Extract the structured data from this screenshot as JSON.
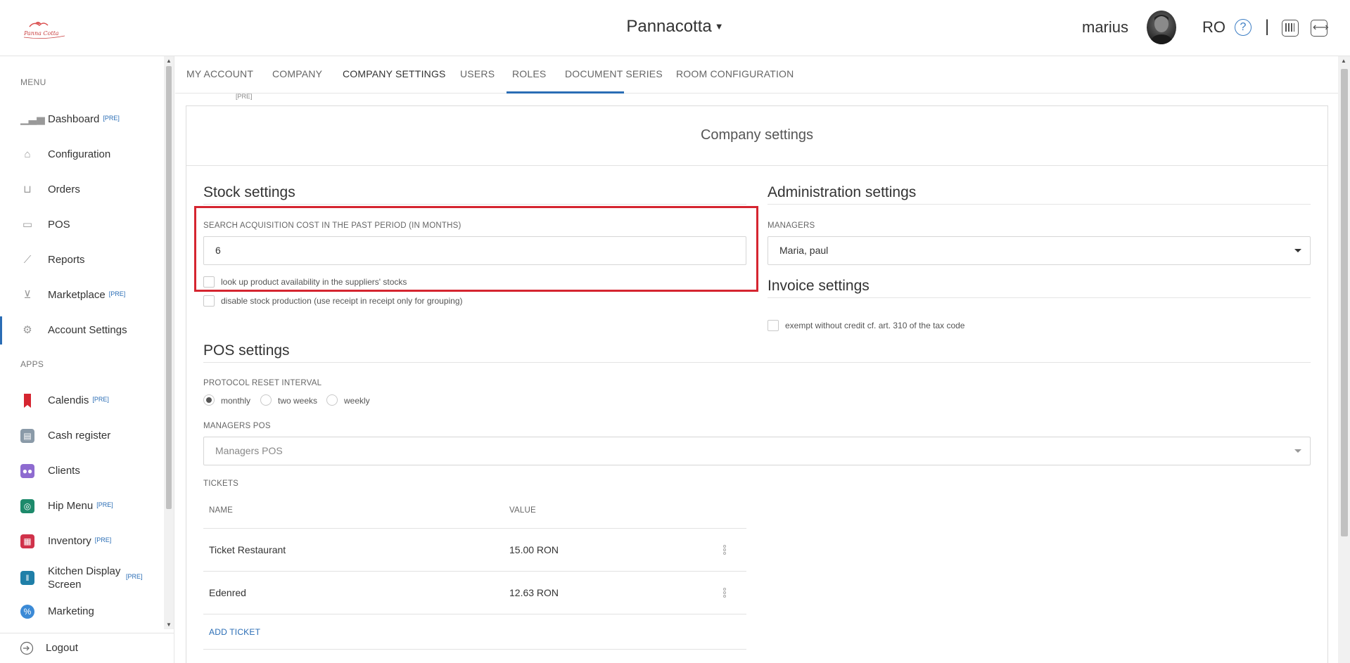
{
  "header": {
    "company_name": "Pannacotta",
    "user_name": "marius",
    "language": "RO",
    "help_icon": "question-circle-icon",
    "separator": "|"
  },
  "sidebar": {
    "menu_title": "MENU",
    "apps_title": "APPS",
    "menu_items": [
      {
        "label": "Dashboard",
        "badge": "[PRE]",
        "icon": "bar-chart-icon"
      },
      {
        "label": "Configuration",
        "badge": "",
        "icon": "tag-icon"
      },
      {
        "label": "Orders",
        "badge": "",
        "icon": "basket-icon"
      },
      {
        "label": "POS",
        "badge": "",
        "icon": "monitor-icon"
      },
      {
        "label": "Reports",
        "badge": "",
        "icon": "line-chart-icon"
      },
      {
        "label": "Marketplace",
        "badge": "[PRE]",
        "icon": "cart-icon"
      },
      {
        "label": "Account Settings",
        "badge": "",
        "icon": "gear-icon"
      }
    ],
    "app_items": [
      {
        "label": "Calendis",
        "badge": "[PRE]",
        "icon": "bookmark-icon",
        "color": "#d52530"
      },
      {
        "label": "Cash register",
        "badge": "",
        "icon": "cash-register-icon",
        "color": "#8a9aa8"
      },
      {
        "label": "Clients",
        "badge": "",
        "icon": "users-icon",
        "color": "#8e6bd0"
      },
      {
        "label": "Hip Menu",
        "badge": "[PRE]",
        "icon": "compass-icon",
        "color": "#1d8a6b"
      },
      {
        "label": "Inventory",
        "badge": "[PRE]",
        "icon": "inventory-icon",
        "color": "#d0324a"
      },
      {
        "label": "Kitchen Display Screen",
        "badge": "[PRE]",
        "icon": "cutlery-icon",
        "color": "#1f7fa8"
      },
      {
        "label": "Marketing",
        "badge": "",
        "icon": "percent-icon",
        "color": "#3b8ad6"
      }
    ],
    "logout_label": "Logout"
  },
  "tabs": [
    {
      "label": "MY ACCOUNT"
    },
    {
      "label": "COMPANY"
    },
    {
      "label": "COMPANY SETTINGS"
    },
    {
      "label": "USERS"
    },
    {
      "label": "ROLES"
    },
    {
      "label": "DOCUMENT SERIES"
    },
    {
      "label": "ROOM CONFIGURATION"
    }
  ],
  "active_tab": "COMPANY SETTINGS",
  "pre_mark": "[PRE]",
  "panel": {
    "title": "Company settings",
    "stock": {
      "heading": "Stock settings",
      "acq_label": "SEARCH ACQUISITION COST IN THE PAST PERIOD (IN MONTHS)",
      "acq_value": "6",
      "check1": "look up product availability in the suppliers' stocks",
      "check2": "disable stock production (use receipt in receipt only for grouping)"
    },
    "admin": {
      "heading": "Administration settings",
      "managers_label": "MANAGERS",
      "managers_value": "Maria, paul"
    },
    "invoice": {
      "heading": "Invoice settings",
      "check1": "exempt without credit cf. art. 310 of the tax code"
    },
    "pos": {
      "heading": "POS settings",
      "reset_label": "PROTOCOL RESET INTERVAL",
      "options": [
        "monthly",
        "two weeks",
        "weekly"
      ],
      "selected": "monthly",
      "managers_pos_label": "MANAGERS POS",
      "managers_pos_placeholder": "Managers POS",
      "tickets_label": "TICKETS",
      "col_name": "NAME",
      "col_value": "VALUE",
      "tickets": [
        {
          "name": "Ticket Restaurant",
          "value": "15.00 RON"
        },
        {
          "name": "Edenred",
          "value": "12.63 RON"
        }
      ],
      "add_ticket": "ADD TICKET"
    }
  }
}
